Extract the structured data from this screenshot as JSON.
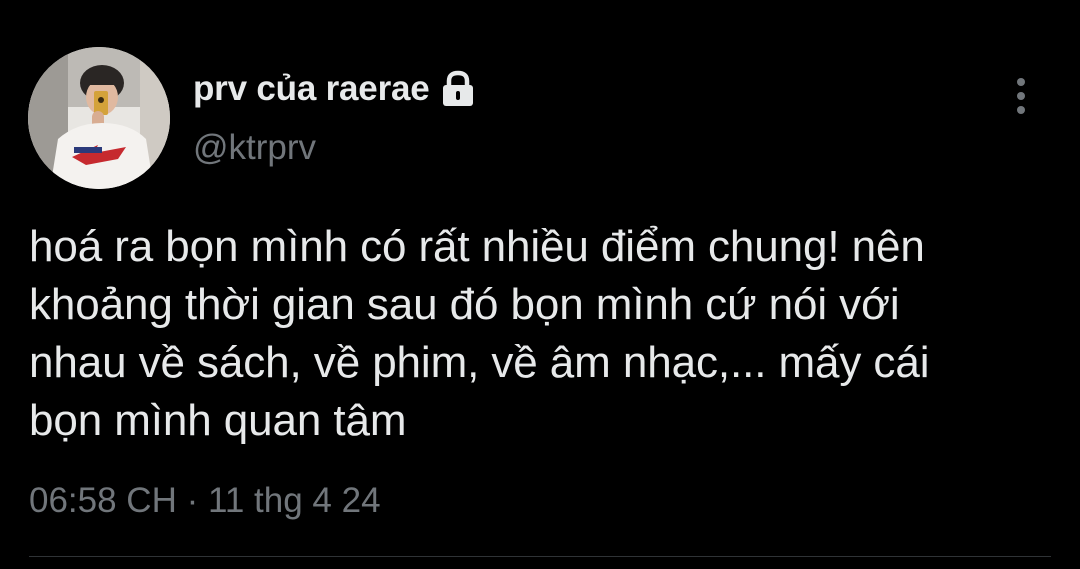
{
  "author": {
    "display_name": "prv của raerae",
    "handle": "@ktrprv",
    "protected_icon": "lock-icon",
    "avatar": "avatar-photo"
  },
  "more_options_icon": "more-vertical-icon",
  "tweet": {
    "text": "hoá ra bọn mình có rất nhiều điểm chung! nên\nkhoảng thời gian sau đó bọn mình cứ nói với\nnhau về sách, về phim, về âm nhạc,... mấy cái\nbọn mình quan tâm",
    "time": "06:58 CH",
    "separator": " · ",
    "date": "11 thg 4 24"
  },
  "colors": {
    "background": "#000000",
    "primary_text": "#e7e9ea",
    "secondary_text": "#71767b",
    "divider": "#2f3336"
  }
}
